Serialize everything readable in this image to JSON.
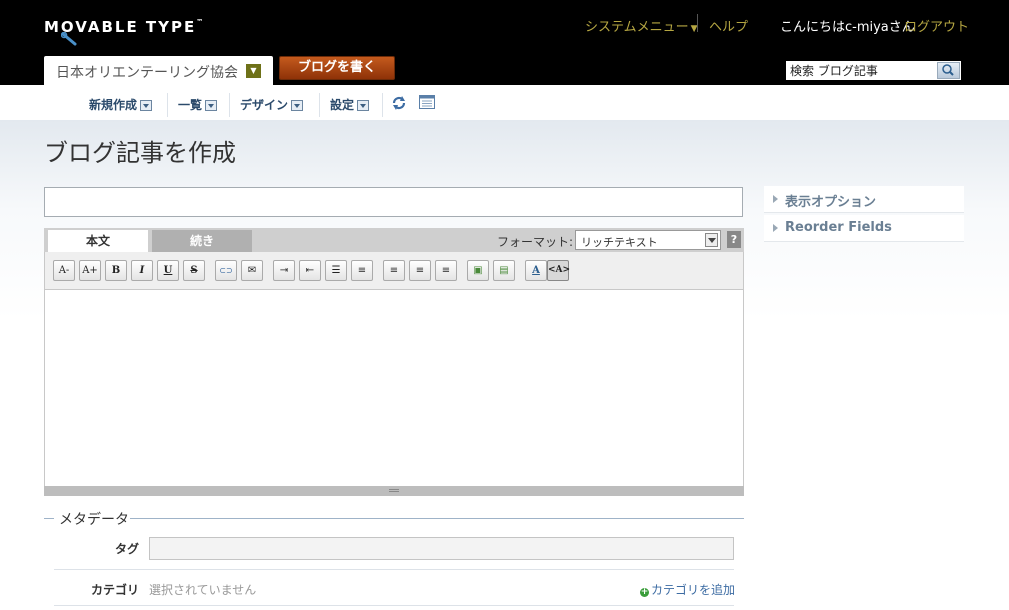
{
  "header": {
    "logo": "MOVABLE TYPE",
    "logo_tm": "™",
    "system_menu": "システムメニュー",
    "help": "ヘルプ",
    "greeting": "こんにちはc-miyaさん",
    "logout": "ログアウト",
    "blog_name": "日本オリエンテーリング協会",
    "write_button": "ブログを書く",
    "search_value": "検索 ブログ記事"
  },
  "menu": {
    "items": [
      {
        "label": "新規作成"
      },
      {
        "label": "一覧"
      },
      {
        "label": "デザイン"
      },
      {
        "label": "設定"
      }
    ]
  },
  "page": {
    "title": "ブログ記事を作成",
    "title_input_value": ""
  },
  "editor": {
    "tabs": [
      {
        "label": "本文",
        "active": true
      },
      {
        "label": "続き",
        "active": false
      }
    ],
    "format_label": "フォーマット:",
    "format_value": "リッチテキスト",
    "help_label": "?",
    "toolbar": [
      {
        "name": "font-size-smaller",
        "glyph": "A-"
      },
      {
        "name": "font-size-larger",
        "glyph": "A+"
      },
      {
        "name": "bold",
        "glyph": "B"
      },
      {
        "name": "italic",
        "glyph": "I"
      },
      {
        "name": "underline",
        "glyph": "U"
      },
      {
        "name": "strikethrough",
        "glyph": "S"
      },
      {
        "name": "link",
        "glyph": "⊂⊃"
      },
      {
        "name": "email-link",
        "glyph": "✉"
      },
      {
        "name": "indent",
        "glyph": "⇥"
      },
      {
        "name": "outdent",
        "glyph": "⇤"
      },
      {
        "name": "unordered-list",
        "glyph": "☰"
      },
      {
        "name": "ordered-list",
        "glyph": "≡"
      },
      {
        "name": "align-left",
        "glyph": "≡"
      },
      {
        "name": "align-center",
        "glyph": "≡"
      },
      {
        "name": "align-right",
        "glyph": "≡"
      },
      {
        "name": "insert-image",
        "glyph": "▣"
      },
      {
        "name": "insert-file",
        "glyph": "▤"
      },
      {
        "name": "text-color",
        "glyph": "A"
      },
      {
        "name": "html-mode",
        "glyph": "<A>"
      }
    ]
  },
  "metadata": {
    "legend": "メタデータ",
    "tag_label": "タグ",
    "tag_value": "",
    "category_label": "カテゴリ",
    "category_none": "選択されていません",
    "category_add": "カテゴリを追加"
  },
  "sidebar": {
    "widgets": [
      {
        "label": "表示オプション"
      },
      {
        "label": "Reorder Fields"
      }
    ]
  }
}
